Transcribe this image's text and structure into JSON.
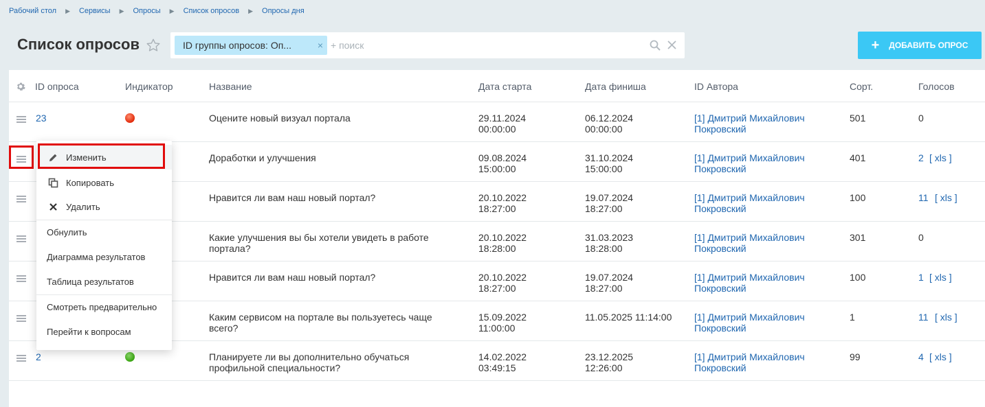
{
  "breadcrumbs": [
    "Рабочий стол",
    "Сервисы",
    "Опросы",
    "Список опросов",
    "Опросы дня"
  ],
  "page_title": "Список опросов",
  "filter": {
    "chip_label": "ID группы опросов: Оп...",
    "chip_close": "×",
    "search_placeholder": "+ поиск"
  },
  "add_button_label": "ДОБАВИТЬ ОПРОС",
  "add_button_plus": "+",
  "columns": {
    "id": "ID опроса",
    "indicator": "Индикатор",
    "name": "Название",
    "start": "Дата старта",
    "finish": "Дата финиша",
    "author": "ID Автора",
    "sort": "Сорт.",
    "votes": "Голосов"
  },
  "rows": [
    {
      "id": "23",
      "indicator": "red",
      "name1": "Оцените новый визуал портала",
      "name2": "",
      "start1": "29.11.2024",
      "start2": "00:00:00",
      "finish1": "06.12.2024",
      "finish2": "00:00:00",
      "author1": "[1] Дмитрий Михайлович",
      "author2": "Покровский",
      "sort": "501",
      "votes": "0",
      "xls": ""
    },
    {
      "id": "",
      "indicator": "",
      "name1": "Доработки и улучшения",
      "name2": "",
      "start1": "09.08.2024",
      "start2": "15:00:00",
      "finish1": "31.10.2024",
      "finish2": "15:00:00",
      "author1": "[1] Дмитрий Михайлович",
      "author2": "Покровский",
      "sort": "401",
      "votes": "2",
      "xls": "[ xls ]"
    },
    {
      "id": "",
      "indicator": "",
      "name1": "Нравится ли вам наш новый портал?",
      "name2": "",
      "start1": "20.10.2022",
      "start2": "18:27:00",
      "finish1": "19.07.2024",
      "finish2": "18:27:00",
      "author1": "[1] Дмитрий Михайлович",
      "author2": "Покровский",
      "sort": "100",
      "votes": "11",
      "xls": "[ xls ]"
    },
    {
      "id": "",
      "indicator": "",
      "name1": "Какие улучшения вы бы хотели увидеть в работе",
      "name2": "портала?",
      "start1": "20.10.2022",
      "start2": "18:28:00",
      "finish1": "31.03.2023",
      "finish2": "18:28:00",
      "author1": "[1] Дмитрий Михайлович",
      "author2": "Покровский",
      "sort": "301",
      "votes": "0",
      "xls": ""
    },
    {
      "id": "",
      "indicator": "",
      "name1": "Нравится ли вам наш новый портал?",
      "name2": "",
      "start1": "20.10.2022",
      "start2": "18:27:00",
      "finish1": "19.07.2024",
      "finish2": "18:27:00",
      "author1": "[1] Дмитрий Михайлович",
      "author2": "Покровский",
      "sort": "100",
      "votes": "1",
      "xls": "[ xls ]"
    },
    {
      "id": "",
      "indicator": "",
      "name1": "Каким сервисом на портале вы пользуетесь чаще",
      "name2": "всего?",
      "start1": "15.09.2022",
      "start2": "11:00:00",
      "finish1": "11.05.2025 11:14:00",
      "finish2": "",
      "author1": "[1] Дмитрий Михайлович",
      "author2": "Покровский",
      "sort": "1",
      "votes": "11",
      "xls": "[ xls ]"
    },
    {
      "id": "2",
      "indicator": "green",
      "name1": "Планируете ли вы дополнительно обучаться",
      "name2": "профильной специальности?",
      "start1": "14.02.2022",
      "start2": "03:49:15",
      "finish1": "23.12.2025",
      "finish2": "12:26:00",
      "author1": "[1] Дмитрий Михайлович",
      "author2": "Покровский",
      "sort": "99",
      "votes": "4",
      "xls": "[ xls ]"
    }
  ],
  "context_menu": {
    "edit": "Изменить",
    "copy": "Копировать",
    "delete": "Удалить",
    "reset": "Обнулить",
    "chart": "Диаграмма результатов",
    "table": "Таблица результатов",
    "preview": "Смотреть предварительно",
    "questions": "Перейти к вопросам"
  }
}
